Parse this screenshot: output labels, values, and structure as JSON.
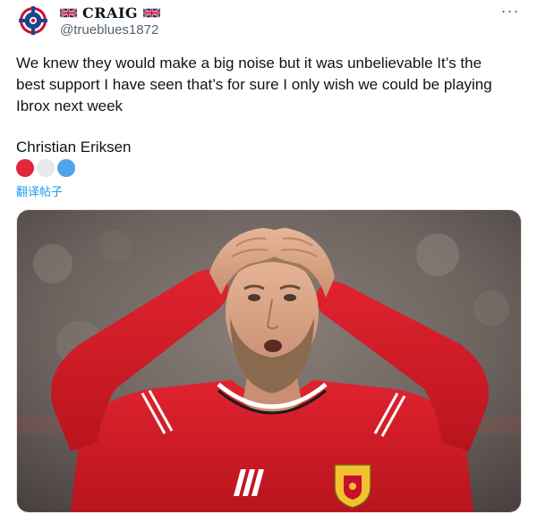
{
  "user": {
    "display_name": "CRAIG",
    "handle": "@trueblues1872",
    "avatar_icon": "rangers-crest-icon",
    "flag_icon": "union-jack-flag-icon"
  },
  "tweet": {
    "lines": [
      "We knew they would make a big noise but it was unbelievable It’s the",
      "best support I have seen that’s for sure I only wish we could be playing",
      "Ibrox next week"
    ],
    "signature": "Christian Eriksen",
    "emoji_dots": [
      "#e0283a",
      "#e8e8ea",
      "#4fa3ea"
    ],
    "translate_label": "翻译帖子"
  },
  "toolbar": {
    "more_label": "···"
  },
  "colors": {
    "accent": "#1d9bf0",
    "shirt_red": "#d8202c",
    "secondary_text": "#536471"
  },
  "media": {
    "description_icon": "photo-player-hands-on-head"
  }
}
